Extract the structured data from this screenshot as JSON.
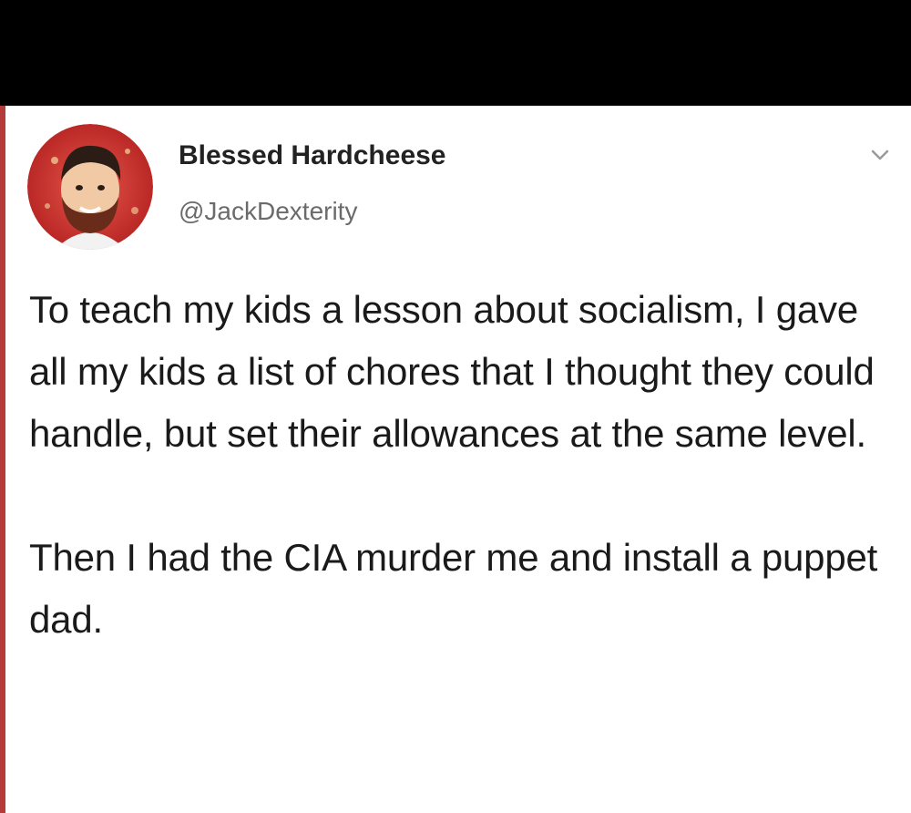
{
  "tweet": {
    "display_name": "Blessed Hardcheese",
    "handle": "@JackDexterity",
    "paragraphs": [
      "To teach my kids a lesson about socialism, I gave all my kids a list of chores that I thought they could handle, but set their allowances at the same level.",
      "Then I had the CIA murder me and install a puppet dad."
    ],
    "menu_icon": "chevron-down-icon",
    "avatar_icon": "user-avatar"
  },
  "colors": {
    "card_background": "#ffffff",
    "page_background": "#000000",
    "left_accent": "#b53a3a",
    "name_text": "#222222",
    "handle_text": "#6b6b6b",
    "body_text": "#1a1a1a"
  }
}
